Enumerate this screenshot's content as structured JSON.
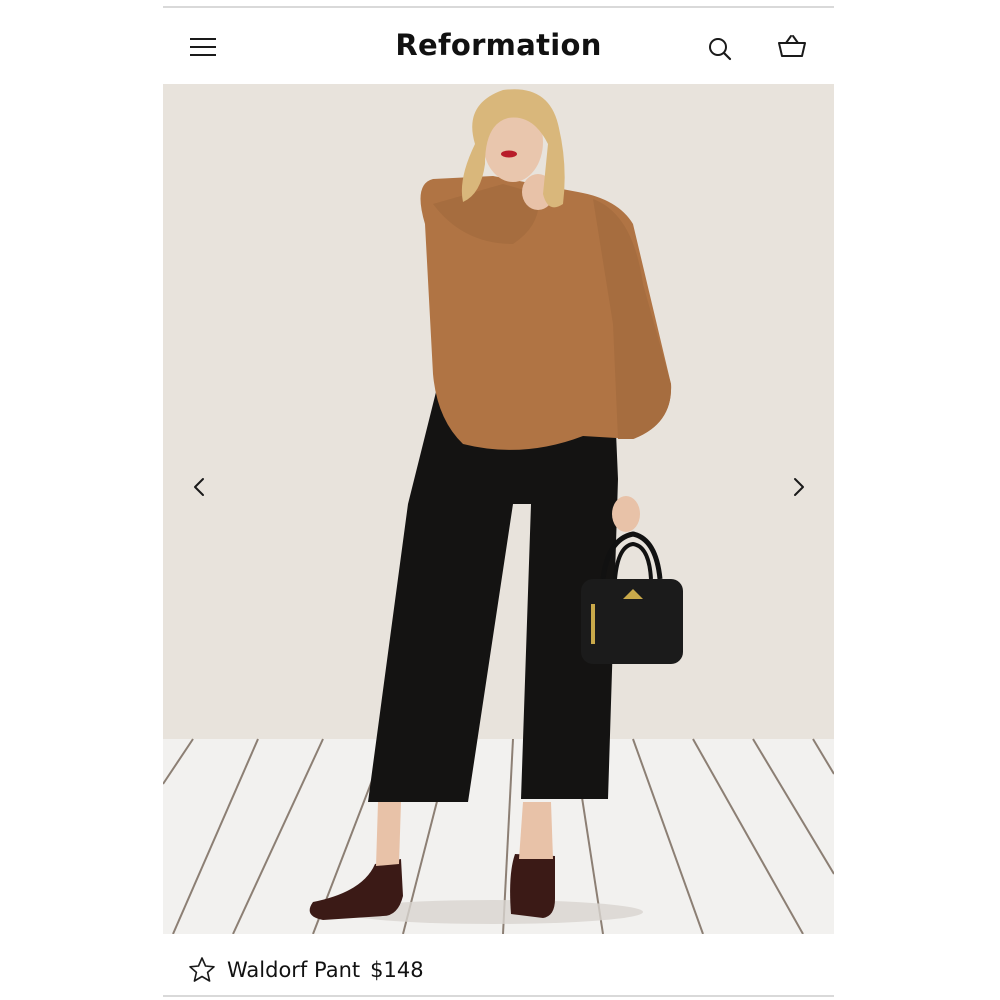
{
  "header": {
    "brand": "Reformation",
    "menu_icon": "hamburger-menu-icon",
    "search_icon": "search-icon",
    "bag_icon": "shopping-bag-icon"
  },
  "hero": {
    "prev_icon": "chevron-left-icon",
    "next_icon": "chevron-right-icon"
  },
  "product": {
    "favorite_icon": "star-outline-icon",
    "name": "Waldorf Pant",
    "price": "$148"
  },
  "colors": {
    "text": "#111111",
    "divider": "#d9d9d9",
    "backdrop": "#e8e3dd"
  }
}
